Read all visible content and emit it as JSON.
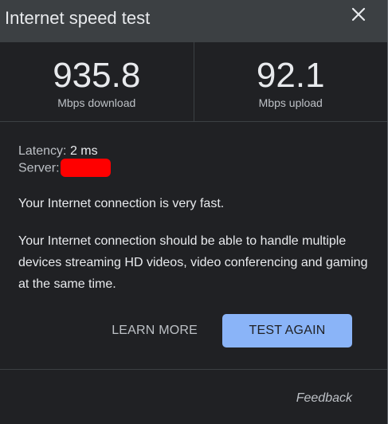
{
  "header": {
    "title": "Internet speed test",
    "close_icon": "close-icon"
  },
  "results": {
    "download": {
      "value": "935.8",
      "unit": "Mbps download"
    },
    "upload": {
      "value": "92.1",
      "unit": "Mbps upload"
    }
  },
  "details": {
    "latency_label": "Latency:",
    "latency_value": "2 ms",
    "server_label": "Server:",
    "server_redaction_color": "#ff0000",
    "summary": "Your Internet connection is very fast.",
    "description": "Your Internet connection should be able to handle multiple devices streaming HD videos, video conferencing and gaming at the same time."
  },
  "actions": {
    "learn_more": "LEARN MORE",
    "test_again": "TEST AGAIN"
  },
  "footer": {
    "feedback": "Feedback"
  },
  "colors": {
    "background": "#202124",
    "header": "#3c4043",
    "accent": "#8ab4f8"
  }
}
